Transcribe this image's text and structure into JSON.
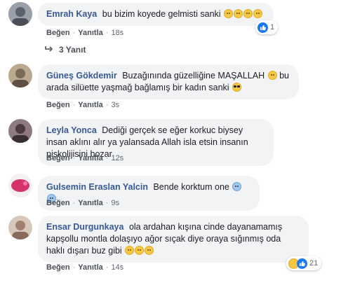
{
  "comments": [
    {
      "author": "Emrah Kaya",
      "text": "bu bizim koyede gelmisti sanki",
      "time": "18s",
      "reaction_count": "1",
      "avatar_color": "#8a8f99"
    },
    {
      "author": "Güneş Gökdemir",
      "text": "Buzağınında güzelliğine MAŞALLAH",
      "text2": "bu arada silüette yaşmağ bağlamış bir kadın sanki",
      "time": "3s",
      "avatar_color": "#7a6a58"
    },
    {
      "author": "Leyla Yonca",
      "text": "Dediği gerçek se eğer korkuc biysey insan aklını alır ya yalansada Allah isla etsin insanın piskolijisini bozar",
      "time": "12s",
      "avatar_color": "#5a4a50"
    },
    {
      "author": "Gulsemin Eraslan Yalcin",
      "text": "Bende korktum one",
      "time": "9s",
      "avatar_color": "#d6336c"
    },
    {
      "author": "Ensar Durgunkaya",
      "text": "ola ardahan kışına cinde dayanamamış kapşollu montla dolaşıyo ağor sıçak diye oraya sığınmış oda haklı dışarı buz gibi",
      "time": "14s",
      "reaction_count": "21",
      "avatar_color": "#b49a88"
    }
  ],
  "actions": {
    "like": "Beğen",
    "reply": "Yanıtla"
  },
  "replies_label": "3 Yanıt",
  "colors": {
    "author": "#385898",
    "bubble": "#f2f3f5",
    "like_blue": "#1877f2"
  }
}
